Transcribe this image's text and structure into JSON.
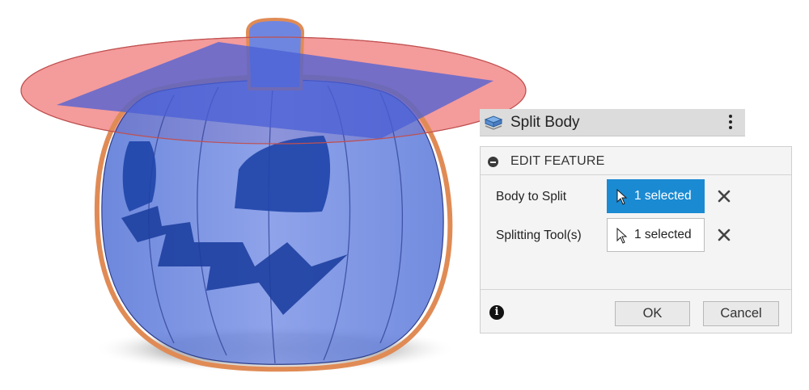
{
  "dialog": {
    "title": "Split Body",
    "title_icon": "split-body-icon",
    "menu_icon": "vertical-ellipsis-icon",
    "section": {
      "label": "EDIT FEATURE",
      "collapse_icon": "collapse-minus-icon"
    },
    "rows": [
      {
        "label": "Body to Split",
        "value": "1 selected",
        "state": "active"
      },
      {
        "label": "Splitting Tool(s)",
        "value": "1 selected",
        "state": "inactive"
      }
    ],
    "buttons": {
      "ok": "OK",
      "cancel": "Cancel"
    },
    "info_icon": "info-icon",
    "info_glyph": "i",
    "accent_color": "#1a8ad2"
  },
  "viewport": {
    "model": "pumpkin-body",
    "split_plane_color": "#f08080",
    "body_color": "#3c5fd6",
    "outline_color": "#e08b55"
  }
}
